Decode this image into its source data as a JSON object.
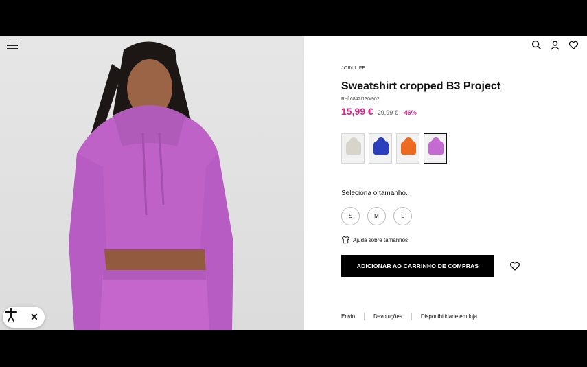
{
  "product": {
    "brand_tag": "JOIN LIFE",
    "title": "Sweatshirt cropped B3 Project",
    "ref": "Ref 6842/130/902",
    "price_new": "15,99 €",
    "price_old": "29,99 €",
    "discount": "-46%"
  },
  "colors": [
    {
      "name": "cream",
      "hex": "#d8d4cc"
    },
    {
      "name": "blue",
      "hex": "#2a3fbd"
    },
    {
      "name": "orange",
      "hex": "#ee6a20"
    },
    {
      "name": "purple",
      "hex": "#c56ad2"
    }
  ],
  "sizes": {
    "label": "Seleciona o tamanho.",
    "options": [
      "S",
      "M",
      "L"
    ],
    "help": "Ajuda sobre tamanhos"
  },
  "cart": {
    "button": "ADICIONAR AO CARRINHO DE COMPRAS"
  },
  "tabs": [
    "Envio",
    "Devoluções",
    "Disponibilidade em loja"
  ],
  "icons": {
    "menu": "menu-icon",
    "search": "search-icon",
    "account": "user-icon",
    "wishlist": "heart-icon",
    "accessibility": "accessibility-icon",
    "close": "close-icon",
    "close_glyph": "✕"
  },
  "accent": "#e0218a"
}
